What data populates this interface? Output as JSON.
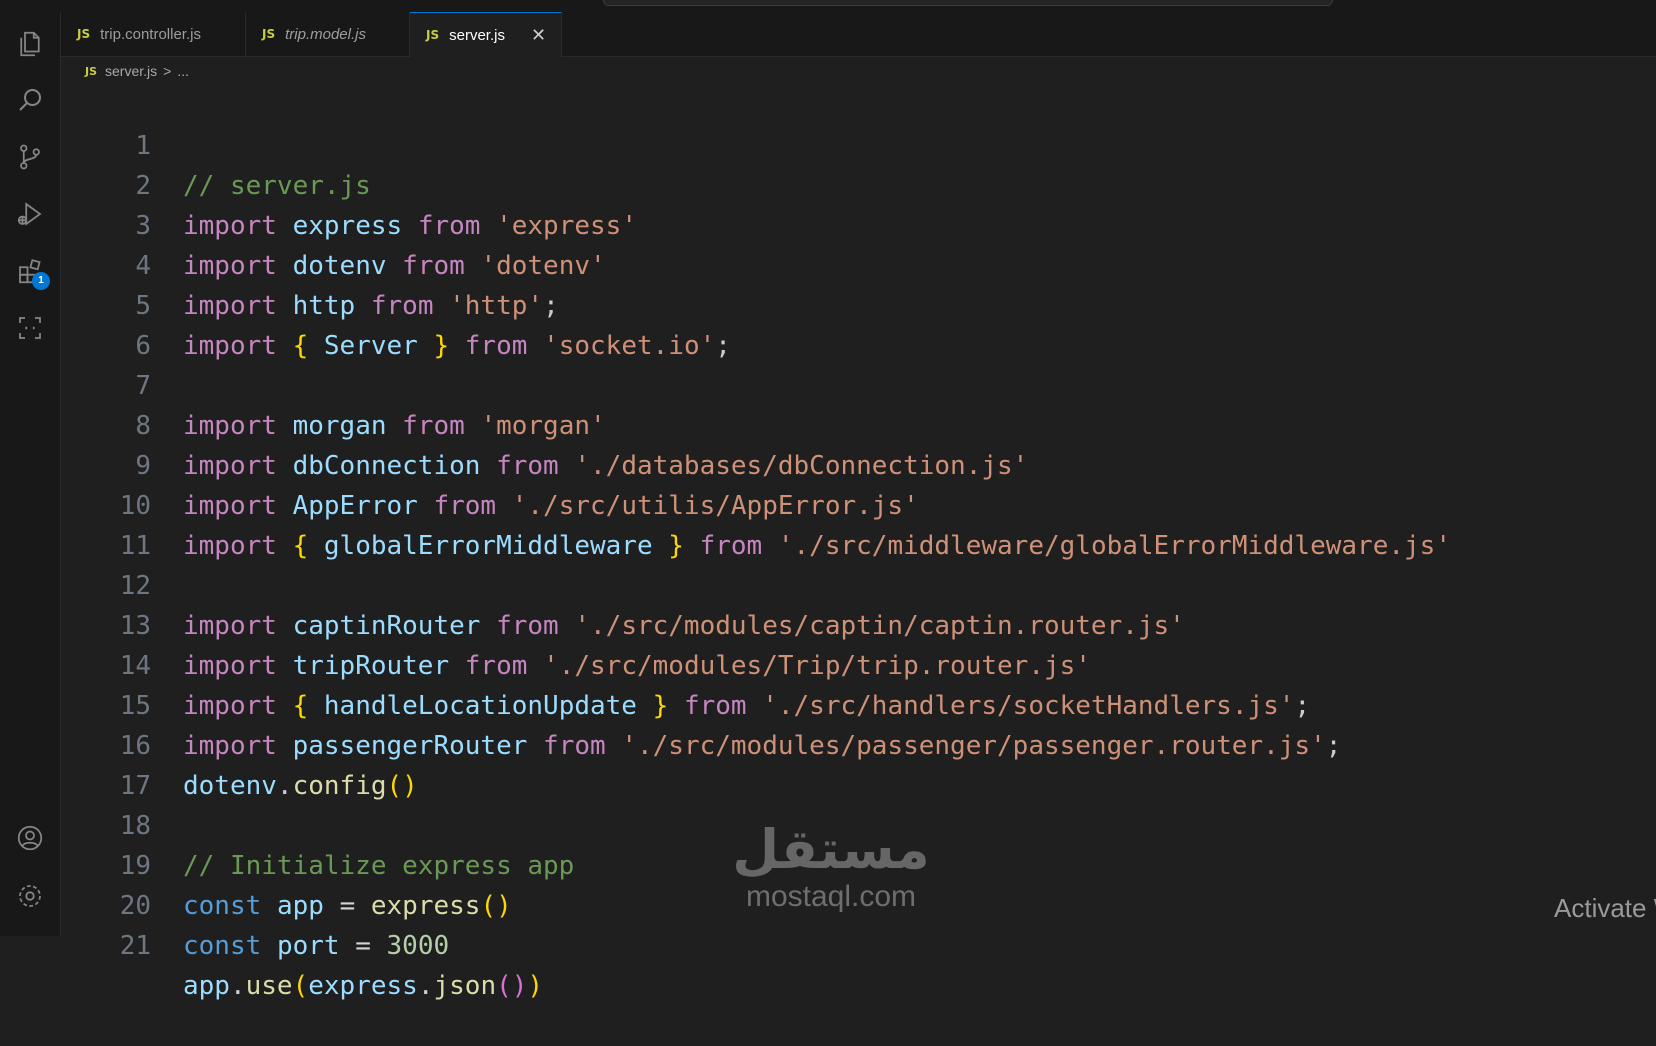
{
  "tabs": [
    {
      "label": "trip.controller.js",
      "icon": "JS",
      "italic": false,
      "active": false
    },
    {
      "label": "trip.model.js",
      "icon": "JS",
      "italic": true,
      "active": false
    },
    {
      "label": "server.js",
      "icon": "JS",
      "italic": false,
      "active": true
    }
  ],
  "breadcrumb": {
    "file": "server.js",
    "separator": ">",
    "rest": "..."
  },
  "activity_bar": {
    "items": [
      "files-icon",
      "search-icon",
      "source-control-icon",
      "run-debug-icon",
      "extensions-icon",
      "remote-explorer-icon"
    ],
    "extensions_badge": "1",
    "bottom": [
      "account-icon",
      "settings-gear-icon"
    ]
  },
  "code_lines": [
    {
      "n": "1",
      "text": "// server.js"
    },
    {
      "n": "2",
      "text": "import express from 'express'"
    },
    {
      "n": "3",
      "text": "import dotenv from 'dotenv'"
    },
    {
      "n": "4",
      "text": "import http from 'http';"
    },
    {
      "n": "5",
      "text": "import { Server } from 'socket.io';"
    },
    {
      "n": "6",
      "text": ""
    },
    {
      "n": "7",
      "text": "import morgan from 'morgan'"
    },
    {
      "n": "8",
      "text": "import dbConnection from './databases/dbConnection.js'"
    },
    {
      "n": "9",
      "text": "import AppError from './src/utilis/AppError.js'"
    },
    {
      "n": "10",
      "text": "import { globalErrorMiddleware } from './src/middleware/globalErrorMiddleware.js'"
    },
    {
      "n": "11",
      "text": ""
    },
    {
      "n": "12",
      "text": "import captinRouter from './src/modules/captin/captin.router.js'"
    },
    {
      "n": "13",
      "text": "import tripRouter from './src/modules/Trip/trip.router.js'"
    },
    {
      "n": "14",
      "text": "import { handleLocationUpdate } from './src/handlers/socketHandlers.js';"
    },
    {
      "n": "15",
      "text": "import passengerRouter from './src/modules/passenger/passenger.router.js';"
    },
    {
      "n": "16",
      "text": "dotenv.config()"
    },
    {
      "n": "17",
      "text": ""
    },
    {
      "n": "18",
      "text": "// Initialize express app"
    },
    {
      "n": "19",
      "text": "const app = express()"
    },
    {
      "n": "20",
      "text": "const port = 3000"
    },
    {
      "n": "21",
      "text": "app.use(express.json())"
    }
  ],
  "watermark": {
    "arabic": "مستقل",
    "latin": "mostaql.com"
  },
  "activate_text": "Activate W"
}
